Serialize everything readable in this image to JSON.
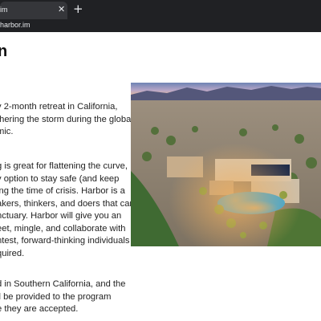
{
  "browser": {
    "tab_title": "im",
    "close_glyph": "✕",
    "new_tab_glyph": "+",
    "url": "harbor.im"
  },
  "page": {
    "heading": "n",
    "paragraphs": [
      [
        "y 2-month retreat in California,",
        "thering the storm during the global",
        "mic."
      ],
      [
        "g is great for flattening the curve,",
        "y option to stay safe (and keep",
        "ing the time of crisis. Harbor is a",
        "akers, thinkers, and doers that can",
        "nctuary. Harbor will give you an",
        "eet, mingle, and collaborate with",
        "ntest, forward-thinking individuals -",
        "quired."
      ],
      [
        "d in Southern California, and the",
        "ll be provided to the program",
        "e they are accepted."
      ]
    ],
    "photo": {
      "subject": "aerial view of desert estate with pool at dusk",
      "icon": "photo-image"
    }
  }
}
